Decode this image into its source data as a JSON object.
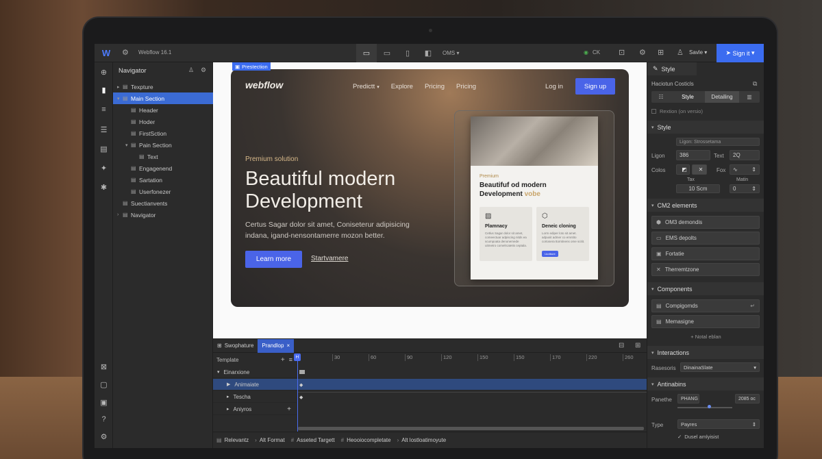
{
  "topbar": {
    "logo": "W",
    "app_name": "Webflow",
    "version": "16.1",
    "cms_label": "OMS",
    "status_label": "CK",
    "save_label": "Savle",
    "signin_label": "Sign it"
  },
  "navigator": {
    "title": "Navigator",
    "items": [
      {
        "label": "Texpture",
        "depth": 0,
        "selected": false
      },
      {
        "label": "Main Section",
        "depth": 0,
        "selected": true
      },
      {
        "label": "Header",
        "depth": 1,
        "selected": false
      },
      {
        "label": "Hoder",
        "depth": 1,
        "selected": false
      },
      {
        "label": "FirstSction",
        "depth": 1,
        "selected": false
      },
      {
        "label": "Pain Section",
        "depth": 1,
        "selected": false
      },
      {
        "label": "Text",
        "depth": 2,
        "selected": false
      },
      {
        "label": "Engagenend",
        "depth": 1,
        "selected": false
      },
      {
        "label": "Sartation",
        "depth": 1,
        "selected": false
      },
      {
        "label": "Userfonezer",
        "depth": 1,
        "selected": false
      },
      {
        "label": "Suectianvents",
        "depth": 0,
        "selected": false
      },
      {
        "label": "Navigator",
        "depth": 0,
        "selected": false
      }
    ]
  },
  "canvas": {
    "selection_tag": "Prestection",
    "site": {
      "brand": "webflow",
      "nav": [
        "Predictt",
        "Explore",
        "Pricing",
        "Pricing"
      ],
      "login": "Log in",
      "signup": "Sign up",
      "eyebrow": "Premium solution",
      "headline_1": "Beautiful modern",
      "headline_2": "Development",
      "body_1": "Certus Sagar dolor sit amet, Coniseterur adipisicing",
      "body_2": "indana, igand-nensontamerre mozon better.",
      "cta_primary": "Learn more",
      "cta_secondary": "Startvamere"
    },
    "card": {
      "eyebrow": "Premium",
      "title_1": "Beautifuf od modern",
      "title_2": "Development",
      "title_accent": "vobe",
      "feature_1_title": "Plamnacy",
      "feature_1_body": "Cetlus Sagar dolor sit amet, comeectuar adpiscing nitds ea scumpoata denonemede uitmetro comelrcatetis ceptala.",
      "feature_2_title": "Deneic cloning",
      "feature_2_body": "Lorm ediper loto sit amet. adpusit admer co emntito cortosera ttomtinens ome scitit.",
      "feature_2_button": "Lkotbure"
    }
  },
  "timeline": {
    "tabs": [
      "Swophature",
      "Prandlop"
    ],
    "template_label": "Template",
    "ticks": [
      "30",
      "60",
      "90",
      "120",
      "150",
      "150",
      "170",
      "220",
      "260"
    ],
    "playhead_label": "H",
    "rows": [
      {
        "label": "Einarxione",
        "selected": false
      },
      {
        "label": "Animaiate",
        "selected": true
      },
      {
        "label": "Tescha",
        "selected": false
      },
      {
        "label": "Aniyros",
        "selected": false
      }
    ]
  },
  "breadcrumbs": [
    "Relevantz",
    "Alt Format",
    "Asseted Targett",
    "Heooiocompletate",
    "Alt lostloatimoyute"
  ],
  "right_panel": {
    "tab": "Style",
    "class_label": "Haciotun Costicls",
    "toggle_style": "Style",
    "toggle_detailing": "Detailing",
    "checkbox_label": "Rextion (on versio)",
    "style_section": "Style",
    "style_field": "Ligon: Strossetama",
    "ligon_label": "Ligon",
    "ligon_value": "386",
    "text_label": "Text",
    "text_value": "2Q",
    "colos_label": "Colos",
    "fox_label": "Fox",
    "tax_label": "Tax",
    "matin_label": "Matin",
    "tax_value": "10 Scm",
    "matin_value": "0",
    "cms_section": "CM2 elements",
    "cms_items": [
      "OM3 demondis",
      "EMS depolts",
      "Fortatie",
      "Therremtzone"
    ],
    "components_section": "Components",
    "components_items": [
      "Compigomds",
      "Memasigne"
    ],
    "add_label": "+ Notal eblan",
    "interactions_section": "Interactions",
    "rasesoris_label": "Rasesoris",
    "rasesoris_value": "DinainaSlate",
    "antinabins_section": "Antinabins",
    "panethe_label": "Panethe",
    "panethe_value": "PHANG",
    "panethe_number": "2085 oc",
    "type_label": "Type",
    "type_value": "Payres",
    "dusel_label": "Dusel amlyisist"
  }
}
